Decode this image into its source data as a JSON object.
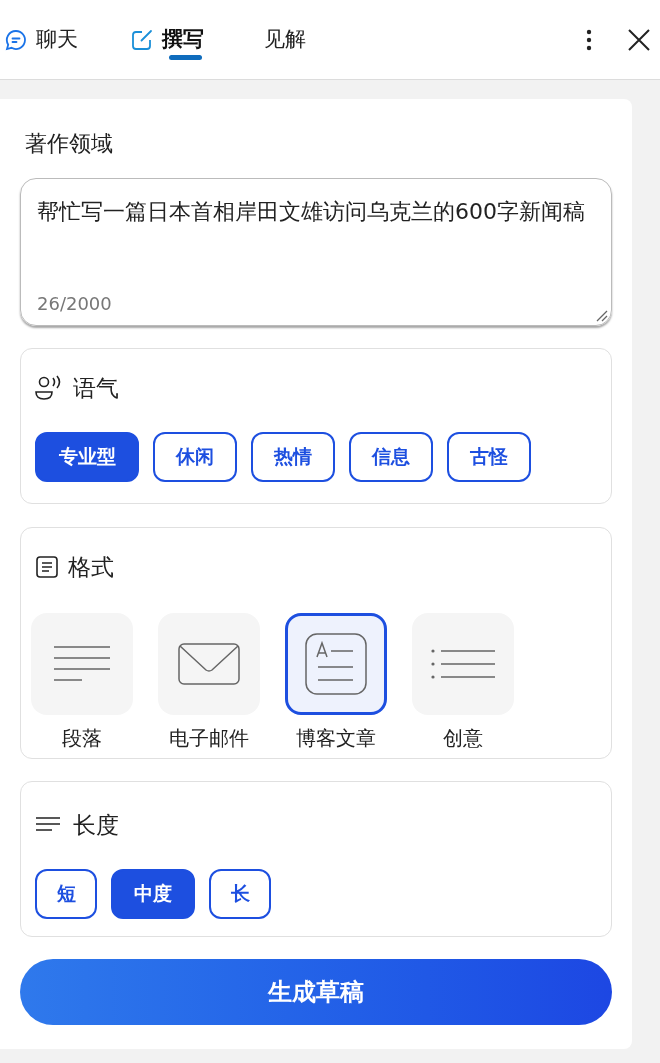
{
  "tabs": [
    {
      "label": "聊天",
      "kind": "chat",
      "selected": false
    },
    {
      "label": "撰写",
      "kind": "compose",
      "selected": true
    },
    {
      "label": "见解",
      "kind": "none",
      "selected": false
    }
  ],
  "section_title": "著作领域",
  "prompt": {
    "value": "帮忙写一篇日本首相岸田文雄访问乌克兰的600字新闻稿",
    "counter": "26/2000"
  },
  "tone": {
    "title": "语气",
    "options": [
      {
        "label": "专业型",
        "selected": true
      },
      {
        "label": "休闲",
        "selected": false
      },
      {
        "label": "热情",
        "selected": false
      },
      {
        "label": "信息",
        "selected": false
      },
      {
        "label": "古怪",
        "selected": false
      }
    ]
  },
  "format": {
    "title": "格式",
    "options": [
      {
        "label": "段落",
        "kind": "paragraph",
        "selected": false
      },
      {
        "label": "电子邮件",
        "kind": "email",
        "selected": false
      },
      {
        "label": "博客文章",
        "kind": "blog",
        "selected": true
      },
      {
        "label": "创意",
        "kind": "ideas",
        "selected": false
      }
    ]
  },
  "length": {
    "title": "长度",
    "options": [
      {
        "label": "短",
        "selected": false
      },
      {
        "label": "中度",
        "selected": true
      },
      {
        "label": "长",
        "selected": false
      }
    ]
  },
  "generate_button": "生成草稿"
}
